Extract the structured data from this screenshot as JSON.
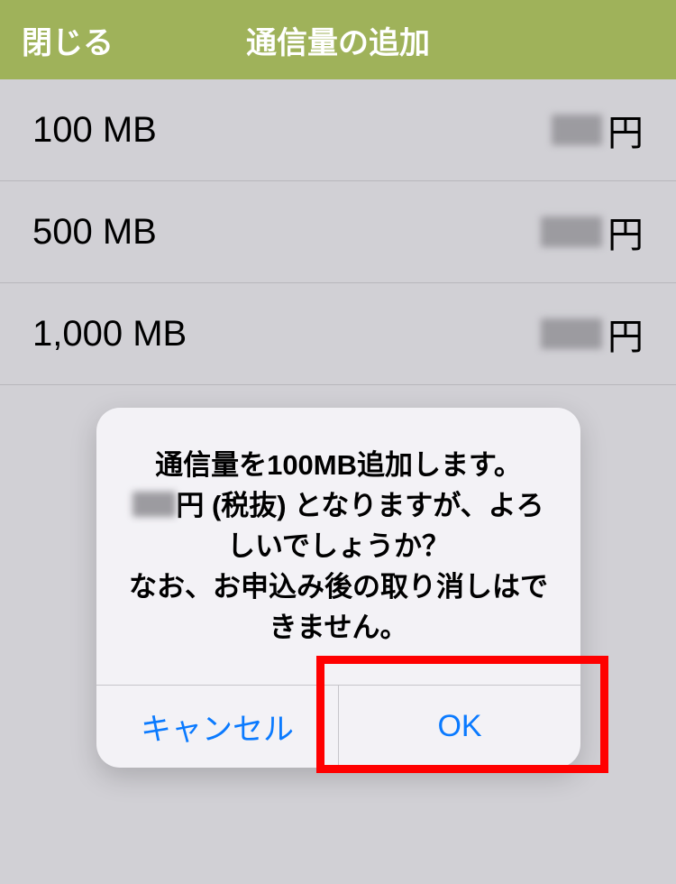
{
  "header": {
    "close_label": "閉じる",
    "title": "通信量の追加"
  },
  "list": {
    "items": [
      {
        "amount": "100 MB",
        "currency": "円"
      },
      {
        "amount": "500 MB",
        "currency": "円"
      },
      {
        "amount": "1,000 MB",
        "currency": "円"
      }
    ]
  },
  "dialog": {
    "line1": "通信量を100MB追加します。",
    "line2_before": "",
    "line2_after": "円 (税抜) となりますが、よろしいでしょうか？",
    "line3": "なお、お申込み後の取り消しはできません。",
    "cancel_label": "キャンセル",
    "ok_label": "OK"
  }
}
